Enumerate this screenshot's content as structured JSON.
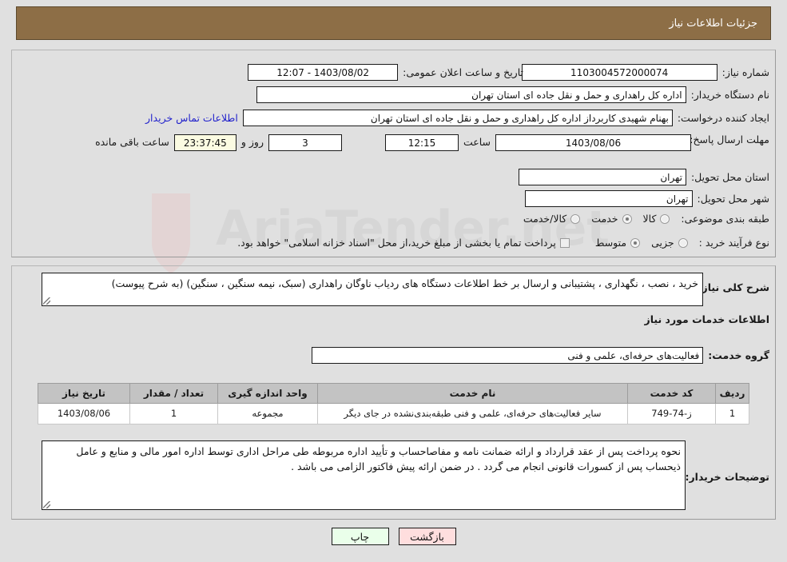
{
  "header": {
    "title": "جزئیات اطلاعات نیاز"
  },
  "colors": {
    "header_bg": "#8d6e46",
    "page_bg": "#e0e0e0",
    "link": "#2222cc",
    "table_header_bg": "#c3c3c3",
    "timer_bg": "#fbfbe2",
    "print_button_bg": "#eaffea",
    "back_button_bg": "#ffdede"
  },
  "form": {
    "need_number_label": "شماره نیاز:",
    "need_number_value": "1103004572000074",
    "announce_datetime_label": "تاریخ و ساعت اعلان عمومی:",
    "announce_datetime_value": "1403/08/02 - 12:07",
    "buyer_org_label": "نام دستگاه خریدار:",
    "buyer_org_value": "اداره کل راهداری و حمل و نقل جاده ای استان تهران",
    "requester_label": "ایجاد کننده درخواست:",
    "requester_value": "بهنام شهیدی کاربرداز اداره کل راهداری و حمل و نقل جاده ای استان تهران",
    "contact_link": "اطلاعات تماس خریدار",
    "deadline_label": "مهلت ارسال پاسخ: تا تاریخ:",
    "deadline_date": "1403/08/06",
    "hour_label": "ساعت",
    "deadline_time": "12:15",
    "days_value": "3",
    "days_label": "روز و",
    "countdown_value": "23:37:45",
    "countdown_label": "ساعت باقی مانده",
    "delivery_province_label": "استان محل تحویل:",
    "delivery_province_value": "تهران",
    "delivery_city_label": "شهر محل تحویل:",
    "delivery_city_value": "تهران",
    "category_label": "طبقه بندی موضوعی:",
    "category_options": [
      {
        "label": "کالا",
        "selected": false
      },
      {
        "label": "خدمت",
        "selected": true
      },
      {
        "label": "کالا/خدمت",
        "selected": false
      }
    ],
    "purchase_type_label": "نوع فرآیند خرید :",
    "purchase_type_options": [
      {
        "label": "جزیی",
        "selected": false
      },
      {
        "label": "متوسط",
        "selected": true
      }
    ],
    "treasury_checkbox_label": "پرداخت تمام یا بخشی از مبلغ خرید،از محل \"اسناد خزانه اسلامی\" خواهد بود.",
    "treasury_checkbox_checked": false
  },
  "description": {
    "label": "شرح کلی نیاز:",
    "value": "خرید ، نصب ، نگهداری ، پشتیبانی و ارسال بر خط اطلاعات دستگاه های ردیاب ناوگان راهداری (سبک، نیمه سنگین ، سنگین) (به شرح پیوست)"
  },
  "services": {
    "section_title": "اطلاعات خدمات مورد نیاز",
    "group_label": "گروه خدمت:",
    "group_value": "فعالیت‌های حرفه‌ای، علمی و فنی",
    "columns": [
      "ردیف",
      "کد خدمت",
      "نام خدمت",
      "واحد اندازه گیری",
      "تعداد / مقدار",
      "تاریخ نیاز"
    ],
    "rows": [
      {
        "index": "1",
        "code": "ز-74-749",
        "name": "سایر فعالیت‌های حرفه‌ای، علمی و فنی طبقه‌بندی‌نشده در جای دیگر",
        "unit": "مجموعه",
        "qty": "1",
        "date": "1403/08/06"
      }
    ]
  },
  "buyer_notes": {
    "label": "توضیحات خریدار:",
    "value": "نحوه پرداخت پس از عقد قرارداد و ارائه ضمانت نامه و مفاصاحساب و تأیید اداره مربوطه طی مراحل اداری توسط اداره امور مالی و منابع و عامل ذیحساب پس از کسورات قانونی انجام می گردد . در ضمن ارائه پیش فاکتور الزامی می باشد ."
  },
  "footer": {
    "print_label": "چاپ",
    "back_label": "بازگشت"
  },
  "watermark": {
    "text": "AriaTender.net"
  }
}
